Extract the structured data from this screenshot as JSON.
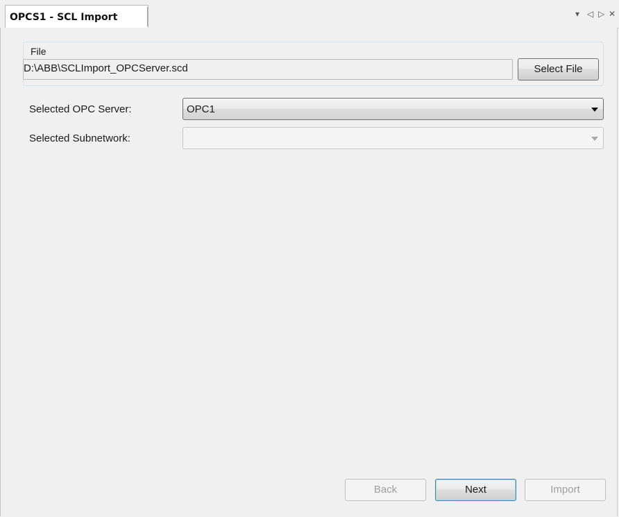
{
  "tab": {
    "title": "OPCS1 - SCL Import"
  },
  "tab_controls": {
    "dropdown_glyph": "▾",
    "left_glyph": "◁",
    "right_glyph": "▷",
    "close_glyph": "✕"
  },
  "file_group": {
    "legend": "File",
    "path": "D:\\ABB\\SCLImport_OPCServer.scd",
    "select_button": "Select File"
  },
  "opc_server": {
    "label": "Selected OPC Server:",
    "value": "OPC1"
  },
  "subnetwork": {
    "label": "Selected Subnetwork:",
    "value": ""
  },
  "footer": {
    "back": "Back",
    "next": "Next",
    "import": "Import"
  }
}
